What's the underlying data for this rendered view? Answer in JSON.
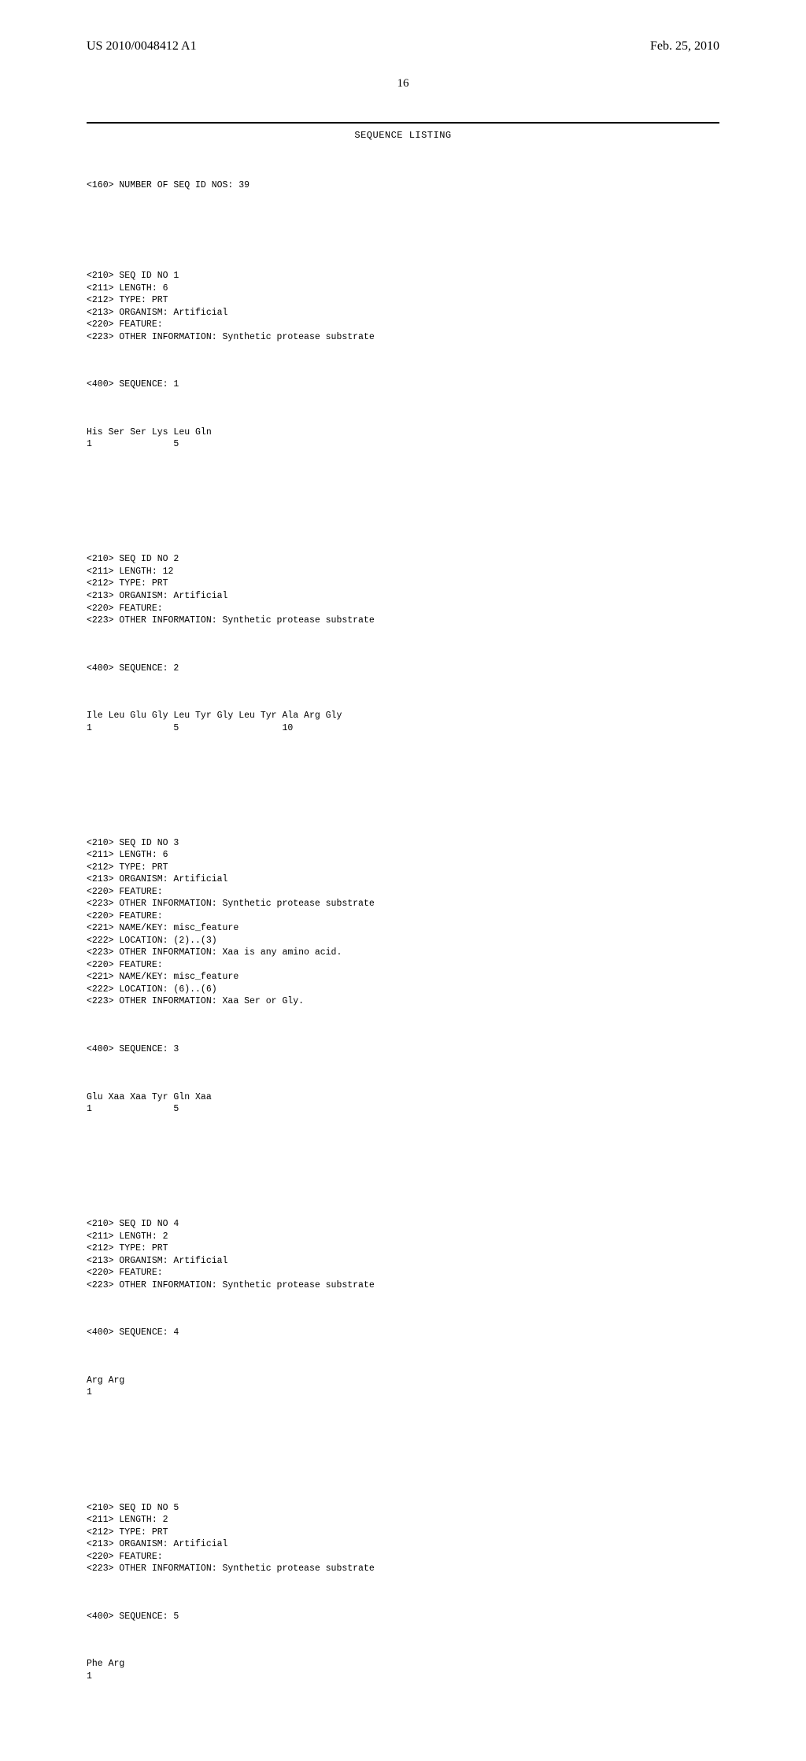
{
  "header": {
    "publication_number": "US 2010/0048412 A1",
    "date": "Feb. 25, 2010"
  },
  "page_number": "16",
  "listing_title": "SEQUENCE LISTING",
  "intro": "<160> NUMBER OF SEQ ID NOS: 39",
  "entries": [
    {
      "meta": "<210> SEQ ID NO 1\n<211> LENGTH: 6\n<212> TYPE: PRT\n<213> ORGANISM: Artificial\n<220> FEATURE:\n<223> OTHER INFORMATION: Synthetic protease substrate",
      "seqlabel": "<400> SEQUENCE: 1",
      "seq": "His Ser Ser Lys Leu Gln\n1               5"
    },
    {
      "meta": "<210> SEQ ID NO 2\n<211> LENGTH: 12\n<212> TYPE: PRT\n<213> ORGANISM: Artificial\n<220> FEATURE:\n<223> OTHER INFORMATION: Synthetic protease substrate",
      "seqlabel": "<400> SEQUENCE: 2",
      "seq": "Ile Leu Glu Gly Leu Tyr Gly Leu Tyr Ala Arg Gly\n1               5                   10"
    },
    {
      "meta": "<210> SEQ ID NO 3\n<211> LENGTH: 6\n<212> TYPE: PRT\n<213> ORGANISM: Artificial\n<220> FEATURE:\n<223> OTHER INFORMATION: Synthetic protease substrate\n<220> FEATURE:\n<221> NAME/KEY: misc_feature\n<222> LOCATION: (2)..(3)\n<223> OTHER INFORMATION: Xaa is any amino acid.\n<220> FEATURE:\n<221> NAME/KEY: misc_feature\n<222> LOCATION: (6)..(6)\n<223> OTHER INFORMATION: Xaa Ser or Gly.",
      "seqlabel": "<400> SEQUENCE: 3",
      "seq": "Glu Xaa Xaa Tyr Gln Xaa\n1               5"
    },
    {
      "meta": "<210> SEQ ID NO 4\n<211> LENGTH: 2\n<212> TYPE: PRT\n<213> ORGANISM: Artificial\n<220> FEATURE:\n<223> OTHER INFORMATION: Synthetic protease substrate",
      "seqlabel": "<400> SEQUENCE: 4",
      "seq": "Arg Arg\n1"
    },
    {
      "meta": "<210> SEQ ID NO 5\n<211> LENGTH: 2\n<212> TYPE: PRT\n<213> ORGANISM: Artificial\n<220> FEATURE:\n<223> OTHER INFORMATION: Synthetic protease substrate",
      "seqlabel": "<400> SEQUENCE: 5",
      "seq": "Phe Arg\n1"
    }
  ]
}
